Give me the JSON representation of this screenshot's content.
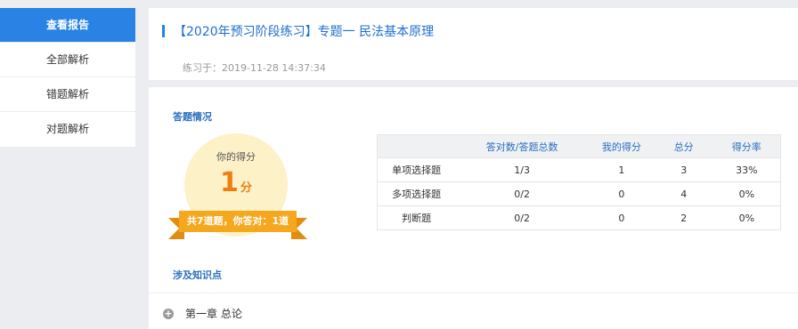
{
  "sidebar": {
    "items": [
      {
        "label": "查看报告"
      },
      {
        "label": "全部解析"
      },
      {
        "label": "错题解析"
      },
      {
        "label": "对题解析"
      }
    ]
  },
  "header": {
    "title": "【2020年预习阶段练习】专题一 民法基本原理",
    "practice_time": "练习于：2019-11-28 14:37:34"
  },
  "answers": {
    "section_title": "答题情况",
    "score_label": "你的得分",
    "score": "1",
    "score_unit": "分",
    "summary": "共7道题，你答对：1道"
  },
  "stats_table": {
    "headers": [
      "",
      "答对数/答题总数",
      "我的得分",
      "总分",
      "得分率"
    ],
    "rows": [
      [
        "单项选择题",
        "1/3",
        "1",
        "3",
        "33%"
      ],
      [
        "多项选择题",
        "0/2",
        "0",
        "4",
        "0%"
      ],
      [
        "判断题",
        "0/2",
        "0",
        "2",
        "0%"
      ]
    ]
  },
  "knowledge": {
    "section_title": "涉及知识点",
    "items": [
      {
        "label": "第一章 总论"
      }
    ]
  },
  "icons": {
    "expand": "plus-circle-icon"
  },
  "colors": {
    "accent": "#2a82e4",
    "score": "#f07d12",
    "ribbon": "#f5a81d"
  }
}
